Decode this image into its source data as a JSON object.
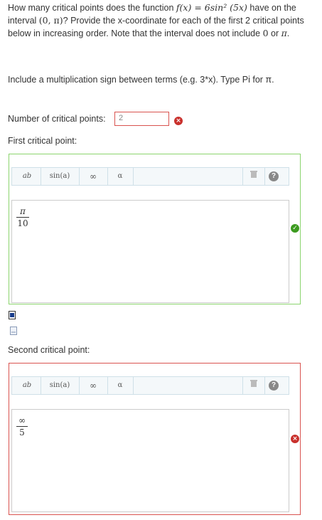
{
  "question": {
    "part1": "How many critical points does the function ",
    "func": "f(x) = 6sin² (5x)",
    "part2": " have on the interval ",
    "interval": "(0, π)",
    "part3": "? Provide the x-coordinate for each of the first 2 critical points below in increasing order. Note that the interval does not include ",
    "zero": "0",
    "or": " or ",
    "pi": "π",
    "end": "."
  },
  "hint": "Include a multiplication sign between terms (e.g. 3*x). Type Pi for π.",
  "num_points": {
    "label": "Number of critical points:",
    "value": "2",
    "status": "incorrect"
  },
  "toolbar": {
    "power": "ab",
    "sin": "sin(a)",
    "infinity": "∞",
    "alpha": "α",
    "help": "?"
  },
  "first": {
    "label": "First critical point:",
    "numerator": "π",
    "denominator": "10",
    "status": "correct",
    "border_color": "#8bd46e"
  },
  "second": {
    "label": "Second critical point:",
    "numerator": "∞",
    "denominator": "5",
    "status": "incorrect",
    "border_color": "#d9534f"
  },
  "icons": {
    "status_incorrect": "×",
    "status_correct": "✓"
  }
}
